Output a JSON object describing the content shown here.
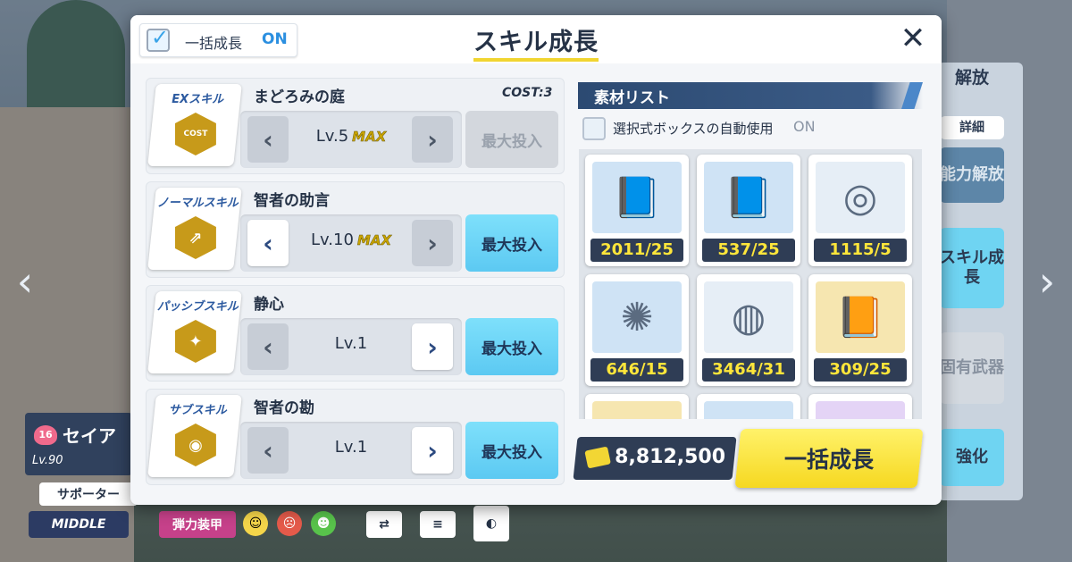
{
  "background": {
    "right_panel": {
      "release_label": "解放",
      "detail_label": "詳細",
      "ability_release_label": "能力解放",
      "skill_growth_label": "スキル成長",
      "unique_weapon_label": "固有武器",
      "enhance_label": "強化"
    },
    "character": {
      "bond_level": "16",
      "name": "セイア",
      "level": "Lv.90"
    },
    "bottom_bar": {
      "role_label": "サポーター",
      "position_label": "MIDDLE",
      "armor_label": "弾力装甲"
    }
  },
  "modal": {
    "title": "スキル成長",
    "bulk_toggle": {
      "label": "一括成長",
      "state": "ON",
      "checked": true
    },
    "skills": [
      {
        "type": "EXスキル",
        "icon": "cost-down-icon",
        "icon_text": "COST",
        "name": "まどろみの庭",
        "cost_label": "COST",
        "cost_value": "3",
        "level": "Lv.5",
        "max_tag": "MAX",
        "prev_enabled": false,
        "next_enabled": false,
        "button_label": "最大投入",
        "button_enabled": false
      },
      {
        "type": "ノーマルスキル",
        "icon": "arrow-boost-icon",
        "name": "智者の助言",
        "level": "Lv.10",
        "max_tag": "MAX",
        "prev_enabled": true,
        "next_enabled": false,
        "button_label": "最大投入",
        "button_enabled": true
      },
      {
        "type": "パッシブスキル",
        "icon": "sparkle-figure-icon",
        "name": "静心",
        "level": "Lv.1",
        "max_tag": "",
        "prev_enabled": false,
        "next_enabled": true,
        "button_label": "最大投入",
        "button_enabled": true
      },
      {
        "type": "サブスキル",
        "icon": "dotted-sphere-icon",
        "name": "智者の勘",
        "level": "Lv.1",
        "max_tag": "",
        "prev_enabled": false,
        "next_enabled": true,
        "button_label": "最大投入",
        "button_enabled": true
      }
    ],
    "materials": {
      "header": "素材リスト",
      "auto_use_label": "選択式ボックスの自動使用",
      "auto_use_state": "ON",
      "items": [
        {
          "icon": "blue-book-icon",
          "count": "2011/25",
          "bg": "#cfe3f5"
        },
        {
          "icon": "blue-book-icon",
          "count": "537/25",
          "bg": "#cfe3f5"
        },
        {
          "icon": "gold-ring-artifact-icon",
          "count": "1115/5",
          "bg": "#e6eef6"
        },
        {
          "icon": "gold-shard-artifact-icon",
          "count": "646/15",
          "bg": "#cfe3f5"
        },
        {
          "icon": "dark-ring-artifact-icon",
          "count": "3464/31",
          "bg": "#e6eef6"
        },
        {
          "icon": "gold-book-icon",
          "count": "309/25",
          "bg": "#f6e6b0"
        },
        {
          "icon": "partial-material-icon",
          "count": "",
          "bg": "#f6e6b0"
        },
        {
          "icon": "partial-material-icon",
          "count": "",
          "bg": "#cfe3f5"
        },
        {
          "icon": "partial-material-icon",
          "count": "",
          "bg": "#e4d4f6"
        }
      ]
    },
    "credits": "8,812,500",
    "bulk_button_label": "一括成長"
  }
}
